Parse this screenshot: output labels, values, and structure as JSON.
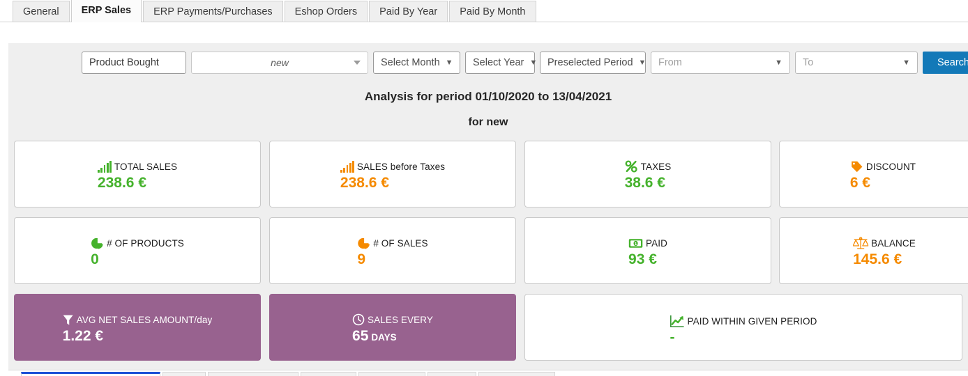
{
  "tabs": [
    {
      "label": "General",
      "active": false
    },
    {
      "label": "ERP Sales",
      "active": true
    },
    {
      "label": "ERP Payments/Purchases",
      "active": false
    },
    {
      "label": "Eshop Orders",
      "active": false
    },
    {
      "label": "Paid By Year",
      "active": false
    },
    {
      "label": "Paid By Month",
      "active": false
    }
  ],
  "filters": {
    "product_bought": "Product Bought",
    "customer_select": "new",
    "select_month": "Select Month",
    "select_year": "Select Year",
    "preselected_period": "Preselected Period",
    "from_placeholder": "From",
    "to_placeholder": "To",
    "search_button": "Search"
  },
  "heading": {
    "title": "Analysis for period 01/10/2020 to 13/04/2021",
    "subtitle": "for new"
  },
  "cards": [
    {
      "label": "TOTAL SALES",
      "value": "238.6 €",
      "color": "#45b22c",
      "icon": "bar-chart-icon",
      "theme": "light"
    },
    {
      "label": "SALES before Taxes",
      "value": "238.6 €",
      "color": "#f58a00",
      "icon": "bar-chart-icon",
      "theme": "light"
    },
    {
      "label": "TAXES",
      "value": "38.6 €",
      "color": "#45b22c",
      "icon": "percent-icon",
      "theme": "light"
    },
    {
      "label": "DISCOUNT",
      "value": "6 €",
      "color": "#f58a00",
      "icon": "tag-icon",
      "theme": "light"
    },
    {
      "label": "# OF PRODUCTS",
      "value": "0",
      "color": "#45b22c",
      "icon": "pie-chart-icon",
      "theme": "light"
    },
    {
      "label": "# OF SALES",
      "value": "9",
      "color": "#f58a00",
      "icon": "pie-chart-icon",
      "theme": "light"
    },
    {
      "label": "PAID",
      "value": "93 €",
      "color": "#45b22c",
      "icon": "banknote-icon",
      "theme": "light"
    },
    {
      "label": "BALANCE",
      "value": "145.6 €",
      "color": "#f58a00",
      "icon": "balance-scale-icon",
      "theme": "light"
    },
    {
      "label": "AVG NET SALES AMOUNT/day",
      "value": "1.22 €",
      "color": "#ffffff",
      "icon": "funnel-icon",
      "theme": "purple"
    },
    {
      "label": "SALES EVERY",
      "value": "65",
      "unit": "DAYS",
      "color": "#ffffff",
      "icon": "clock-icon",
      "theme": "purple"
    },
    {
      "label": "PAID WITHIN GIVEN PERIOD",
      "value": "-",
      "color": "#45b22c",
      "icon": "trend-up-icon",
      "theme": "light"
    }
  ],
  "colors": {
    "green": "#45b22c",
    "orange": "#f58a00",
    "purple": "#98628f",
    "blue": "#1379b8",
    "panel_bg": "#efefef"
  }
}
